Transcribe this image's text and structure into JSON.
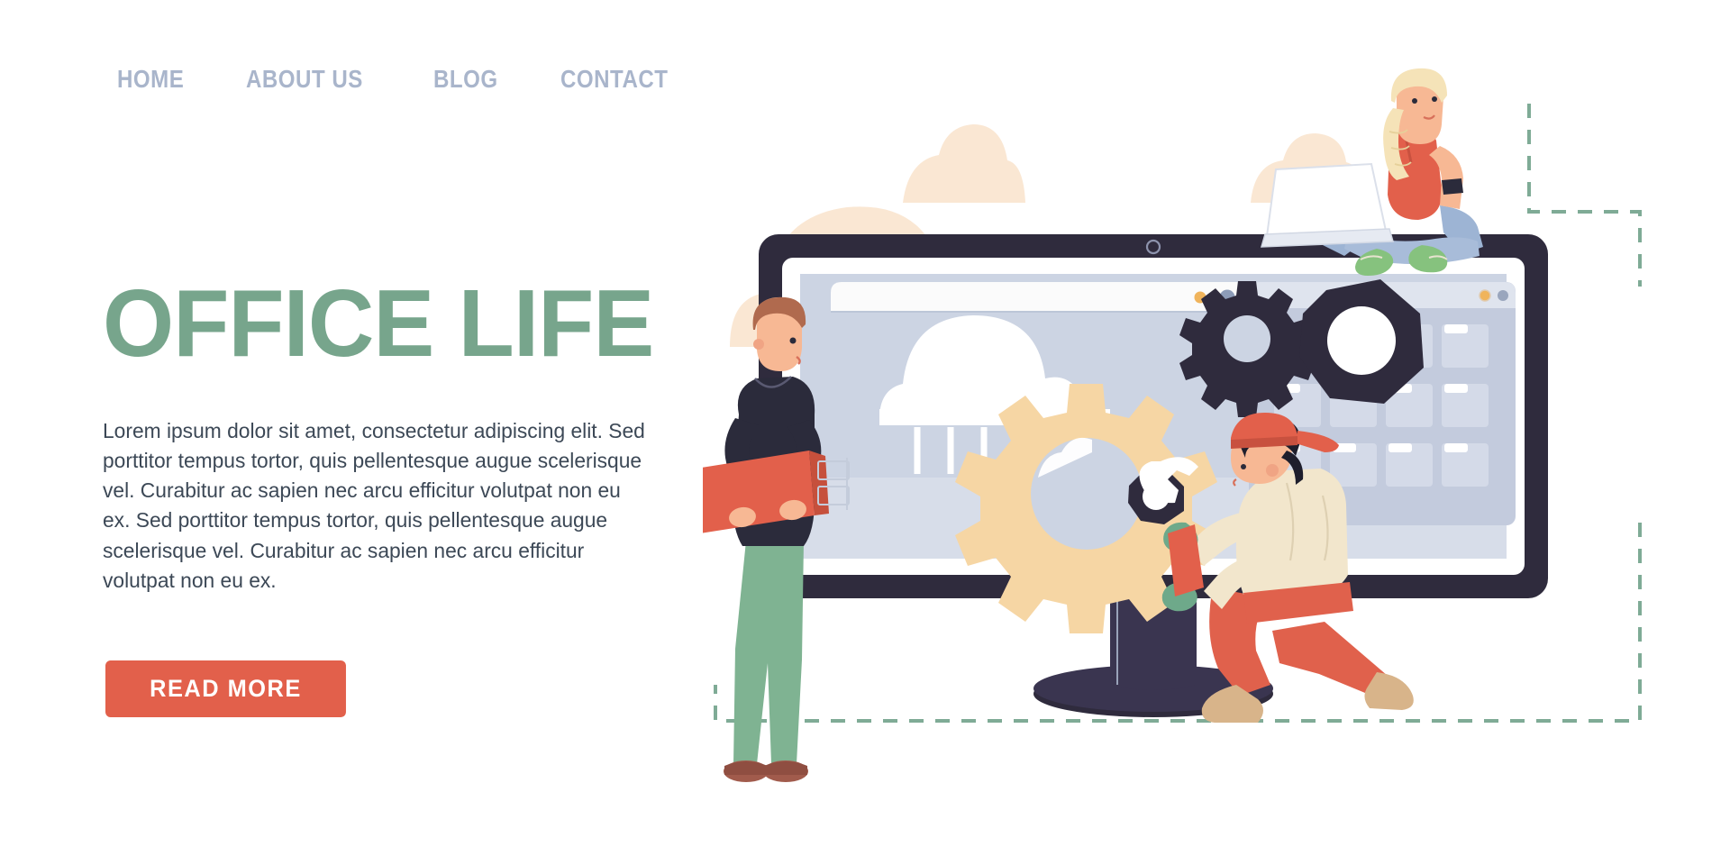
{
  "nav": {
    "items": [
      {
        "label": "HOME",
        "name": "nav-item-home"
      },
      {
        "label": "ABOUT US",
        "name": "nav-item-about-us"
      },
      {
        "label": "BLOG",
        "name": "nav-item-blog"
      },
      {
        "label": "CONTACT",
        "name": "nav-item-contact"
      }
    ]
  },
  "hero": {
    "title": "OFFICE LIFE",
    "paragraph": "Lorem ipsum dolor sit amet, consectetur adipiscing elit. Sed porttitor tempus tortor, quis pellentesque augue scelerisque vel. Curabitur ac sapien nec arcu efficitur volutpat non eu ex. Sed porttitor tempus tortor, quis pellentesque augue scelerisque vel. Curabitur ac sapien nec arcu efficitur volutpat non eu ex.",
    "cta_label": "READ MORE"
  },
  "colors": {
    "page_background": "#ffffff",
    "nav_text": "#a9b5cb",
    "heading_green": "#77a58c",
    "body_text": "#3c4856",
    "cta_background": "#e2604b",
    "cta_text": "#ffffff",
    "cloud_beige": "#fae7d3",
    "monitor_bezel": "#2f2b3d",
    "screen_bluegrey": "#ccd4e3",
    "gear_tan": "#f6d6a4",
    "dashed_green": "#7fab96",
    "browser_dot_orange": "#f0b45c",
    "browser_dot_grey": "#8d9cb8",
    "toolbox_red": "#e2604b",
    "pants_sage": "#7fb392",
    "worker_pants_red": "#e0614c",
    "shirt_cream": "#f2e6cc",
    "skin": "#f7b894",
    "glove_green": "#6ea98a"
  },
  "illustration": {
    "name": "office-life-illustration",
    "description": "Workers maintaining a giant desktop monitor",
    "elements": {
      "background_clouds": "3 beige clouds",
      "monitor": "large desktop monitor with dark navy bezel and stand",
      "browser_window": "window with cloud and rain graphic, orange and grey dots",
      "gears": "large tan gear, dark gear, dark octagonal nut, small dark nut",
      "file_grid": "panel with 4 by 3 grid of folder tiles",
      "character_standing": "man in dark hoodie and sage pants carrying red toolbox",
      "character_kneeling": "man in red cap, cream shirt, red pants with wrench",
      "character_laptop": "blonde woman sitting cross legged with laptop on monitor top",
      "dashed_frame": "dashed green decorative outline"
    }
  }
}
